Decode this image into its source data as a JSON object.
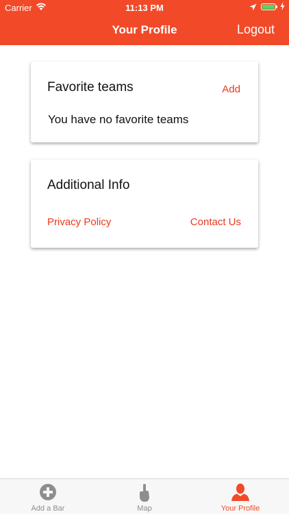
{
  "status_bar": {
    "carrier": "Carrier",
    "time": "11:13 PM",
    "battery_color": "#4cd964"
  },
  "nav": {
    "title": "Your Profile",
    "logout_label": "Logout",
    "background_color": "#f24a28"
  },
  "favorite_teams": {
    "title": "Favorite teams",
    "add_label": "Add",
    "empty_text": "You have no favorite teams"
  },
  "additional_info": {
    "title": "Additional Info",
    "privacy_label": "Privacy Policy",
    "contact_label": "Contact Us"
  },
  "tabs": [
    {
      "label": "Add a Bar",
      "icon": "plus-circle-icon",
      "active": false
    },
    {
      "label": "Map",
      "icon": "hand-icon",
      "active": false
    },
    {
      "label": "Your Profile",
      "icon": "person-icon",
      "active": true
    }
  ],
  "colors": {
    "accent": "#f24a28",
    "link": "#e8391c",
    "tab_inactive": "#8e8e8e"
  }
}
